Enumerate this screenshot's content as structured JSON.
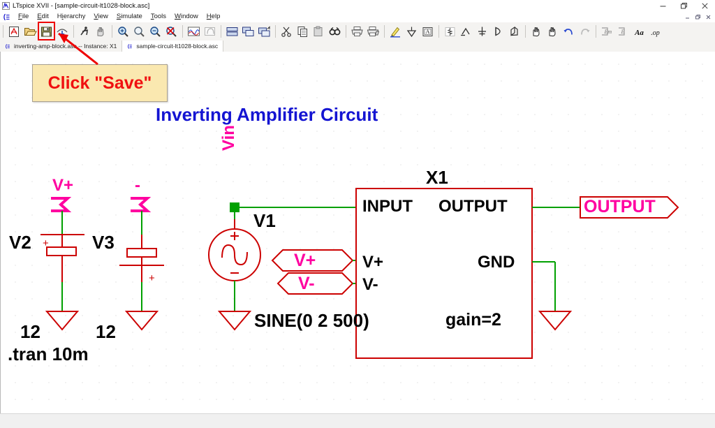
{
  "window": {
    "title": "LTspice XVII - [sample-circuit-lt1028-block.asc]",
    "app_icon": "ltspice-logo-icon",
    "minimize": "minimize-icon",
    "maximize": "restore-icon",
    "close": "close-icon"
  },
  "mdi": {
    "minimize": "mdi-minimize-icon",
    "restore": "mdi-restore-icon",
    "close": "mdi-close-icon"
  },
  "menu": {
    "items": [
      {
        "label": "File",
        "mnemonic": "F"
      },
      {
        "label": "Edit",
        "mnemonic": "E"
      },
      {
        "label": "Hierarchy",
        "mnemonic": "H"
      },
      {
        "label": "View",
        "mnemonic": "V"
      },
      {
        "label": "Simulate",
        "mnemonic": "S"
      },
      {
        "label": "Tools",
        "mnemonic": "T"
      },
      {
        "label": "Window",
        "mnemonic": "W"
      },
      {
        "label": "Help",
        "mnemonic": "H"
      }
    ]
  },
  "toolbar": {
    "groups": [
      [
        "new-schematic-icon",
        "open-file-icon",
        "save-file-icon",
        "print-preview-icon"
      ],
      [
        "run-simulation-icon",
        "halt-simulation-icon"
      ],
      [
        "zoom-area-icon",
        "zoom-back-icon",
        "zoom-out-icon",
        "zoom-full-extents-icon"
      ],
      [
        "waveform-view-icon",
        "spice-error-log-icon"
      ],
      [
        "autorange-icon",
        "tile-horizontally-icon",
        "tile-vertically-icon"
      ],
      [
        "cut-icon",
        "copy-icon",
        "paste-icon",
        "find-icon"
      ],
      [
        "print-icon",
        "print-setup-icon"
      ],
      [
        "draw-wire-icon",
        "ground-icon",
        "label-net-icon"
      ],
      [
        "resistor-icon",
        "capacitor-icon",
        "inductor-icon",
        "diode-icon",
        "component-icon"
      ],
      [
        "move-icon",
        "drag-icon",
        "undo-icon",
        "redo-icon"
      ],
      [
        "mirror-icon",
        "rotate-icon",
        "text-icon",
        "spice-directive-icon"
      ]
    ],
    "highlighted": "save-file-icon"
  },
  "tabs": [
    {
      "label": "inverting-amp-block.asc -- Instance: X1",
      "active": false,
      "icon": "schematic-tab-icon"
    },
    {
      "label": "sample-circuit-lt1028-block.asc",
      "active": true,
      "icon": "schematic-tab-icon"
    }
  ],
  "annotation": {
    "callout_text": "Click \"Save\"",
    "arrow": "pointer-arrow",
    "highlight_target": "save-file-icon",
    "color": "#f01010",
    "bg": "#fae8b0"
  },
  "schematic": {
    "title": "Inverting Amplifier Circuit",
    "title_color": "#1414d2",
    "wire_color": "#00a000",
    "symbol_color": "#cc0000",
    "flag_text_color": "#ff00a0",
    "net_labels": [
      {
        "name": "V+",
        "type": "flag-io",
        "text": "V+"
      },
      {
        "name": "V-",
        "type": "flag-io",
        "text": "-"
      },
      {
        "name": "Vin",
        "type": "flag-net",
        "text": "Vin"
      },
      {
        "name": "Vplus",
        "type": "port-bidir",
        "text": "V+"
      },
      {
        "name": "Vminus",
        "type": "port-bidir",
        "text": "V-"
      },
      {
        "name": "OUTPUT",
        "type": "port-out",
        "text": "OUTPUT"
      }
    ],
    "components": [
      {
        "ref": "V2",
        "value": "12",
        "type": "battery"
      },
      {
        "ref": "V3",
        "value": "12",
        "type": "battery"
      },
      {
        "ref": "V1",
        "value": "SINE(0 2 500)",
        "type": "voltage-source-sine"
      },
      {
        "ref": "X1",
        "value": "gain=2",
        "type": "hierarchical-block"
      }
    ],
    "block": {
      "ref": "X1",
      "pins": [
        "INPUT",
        "OUTPUT",
        "V+",
        "V-",
        "GND"
      ],
      "param": "gain=2"
    },
    "battery_polarity": [
      "+",
      "+"
    ],
    "sine_polarity": [
      "+",
      "−"
    ],
    "directive": ".tran 10m"
  }
}
